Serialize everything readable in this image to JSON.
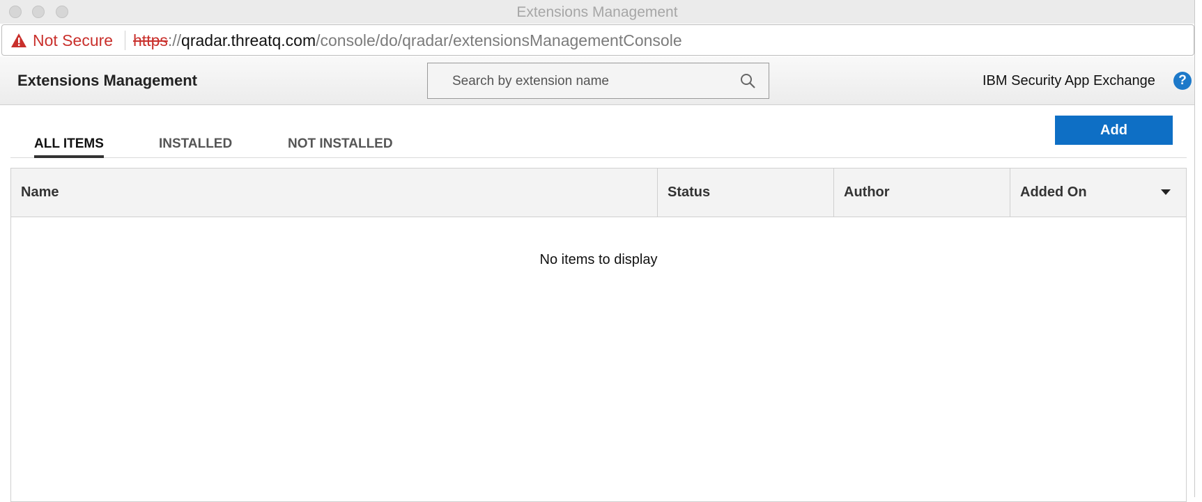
{
  "window": {
    "title": "Extensions Management"
  },
  "browser": {
    "security_label": "Not Secure",
    "url_scheme": "https",
    "url_separator": "://",
    "url_host": "qradar.threatq.com",
    "url_path": "/console/do/qradar/extensionsManagementConsole"
  },
  "header": {
    "title": "Extensions Management",
    "search_placeholder": "Search by extension name",
    "exchange_link": "IBM Security App Exchange",
    "help_glyph": "?"
  },
  "tabs": [
    {
      "label": "ALL ITEMS",
      "active": true
    },
    {
      "label": "INSTALLED",
      "active": false
    },
    {
      "label": "NOT INSTALLED",
      "active": false
    }
  ],
  "actions": {
    "add_label": "Add"
  },
  "table": {
    "columns": [
      "Name",
      "Status",
      "Author",
      "Added On"
    ],
    "sorted_column": "Added On",
    "rows": [],
    "empty_message": "No items to display"
  },
  "colors": {
    "accent": "#0e6fc5",
    "warning": "#c9302c",
    "help": "#1d79c9"
  }
}
